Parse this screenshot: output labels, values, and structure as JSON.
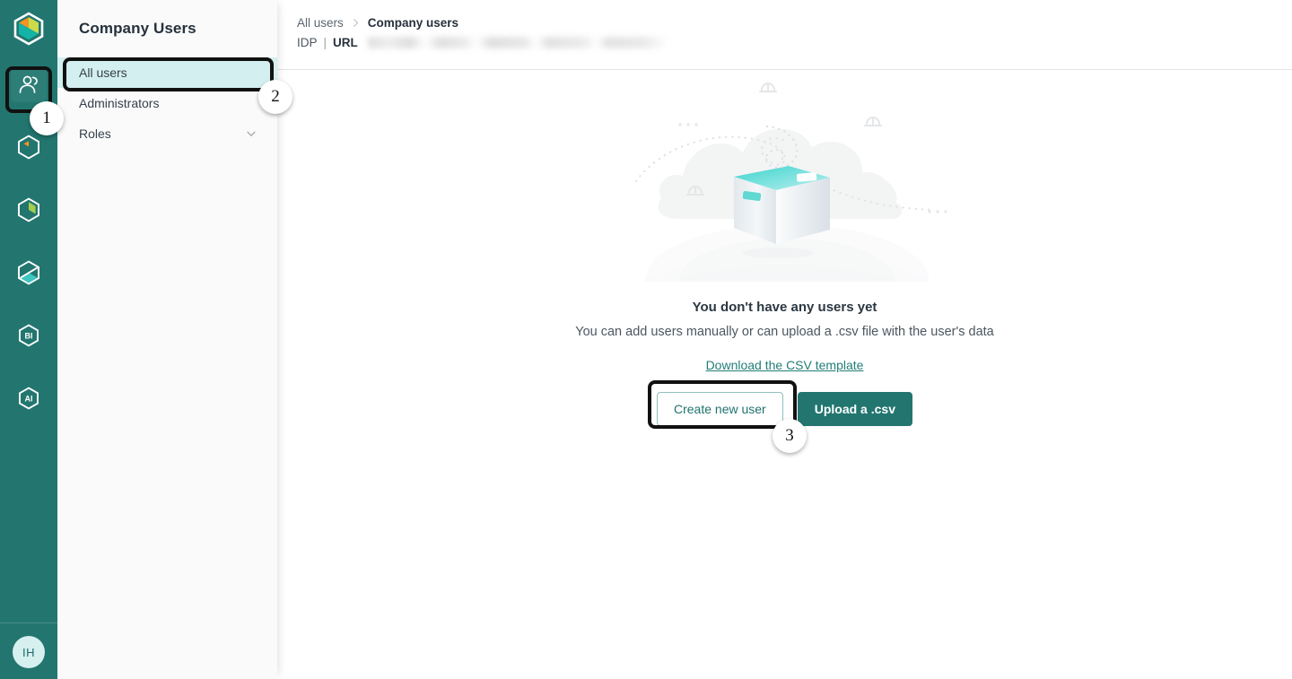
{
  "brand": {
    "logo_icon": "hexagon-logo-icon",
    "rail_bg": "#22766f",
    "accent": "#22766f",
    "selected_nav_bg": "#d3efef",
    "link_color": "#227d76"
  },
  "rail": {
    "items": [
      {
        "icon": "users-icon",
        "name": "rail-item-users",
        "active": true
      },
      {
        "icon": "hexagon-clock-icon",
        "name": "rail-item-hexagon-clock",
        "active": false
      },
      {
        "icon": "hexagon-pie-icon",
        "name": "rail-item-hexagon-pie",
        "active": false
      },
      {
        "icon": "hexagon-slash-icon",
        "name": "rail-item-hexagon-slash",
        "active": false
      },
      {
        "icon": "hexagon-bi-icon",
        "name": "rail-item-bi",
        "label": "BI",
        "active": false
      },
      {
        "icon": "hexagon-ai-icon",
        "name": "rail-item-ai",
        "label": "AI",
        "active": false
      }
    ],
    "avatar": {
      "initials": "IH",
      "icon": "avatar"
    }
  },
  "sidebar": {
    "title": "Company Users",
    "items": [
      {
        "label": "All users",
        "selected": true,
        "expandable": false
      },
      {
        "label": "Administrators",
        "selected": false,
        "expandable": false
      },
      {
        "label": "Roles",
        "selected": false,
        "expandable": true,
        "chevron_icon": "chevron-down-icon"
      }
    ]
  },
  "breadcrumb": {
    "items": [
      "All users",
      "Company users"
    ],
    "separator_icon": "chevron-right-icon"
  },
  "idp": {
    "label": "IDP",
    "pipe": "|",
    "url_label": "URL",
    "url_value": "",
    "url_redacted": true
  },
  "empty_state": {
    "illustration_icon": "empty-box-cloud-illustration",
    "title": "You don't have any users yet",
    "subtitle": "You can add users manually or can upload a .csv file with the user's data",
    "link": "Download the CSV template",
    "primary_button": "Upload a .csv",
    "secondary_button": "Create new user"
  },
  "annotations": [
    {
      "number": "1",
      "target": "rail-item-users"
    },
    {
      "number": "2",
      "target": "sidebar-item-all-users"
    },
    {
      "number": "3",
      "target": "create-new-user-button"
    }
  ]
}
